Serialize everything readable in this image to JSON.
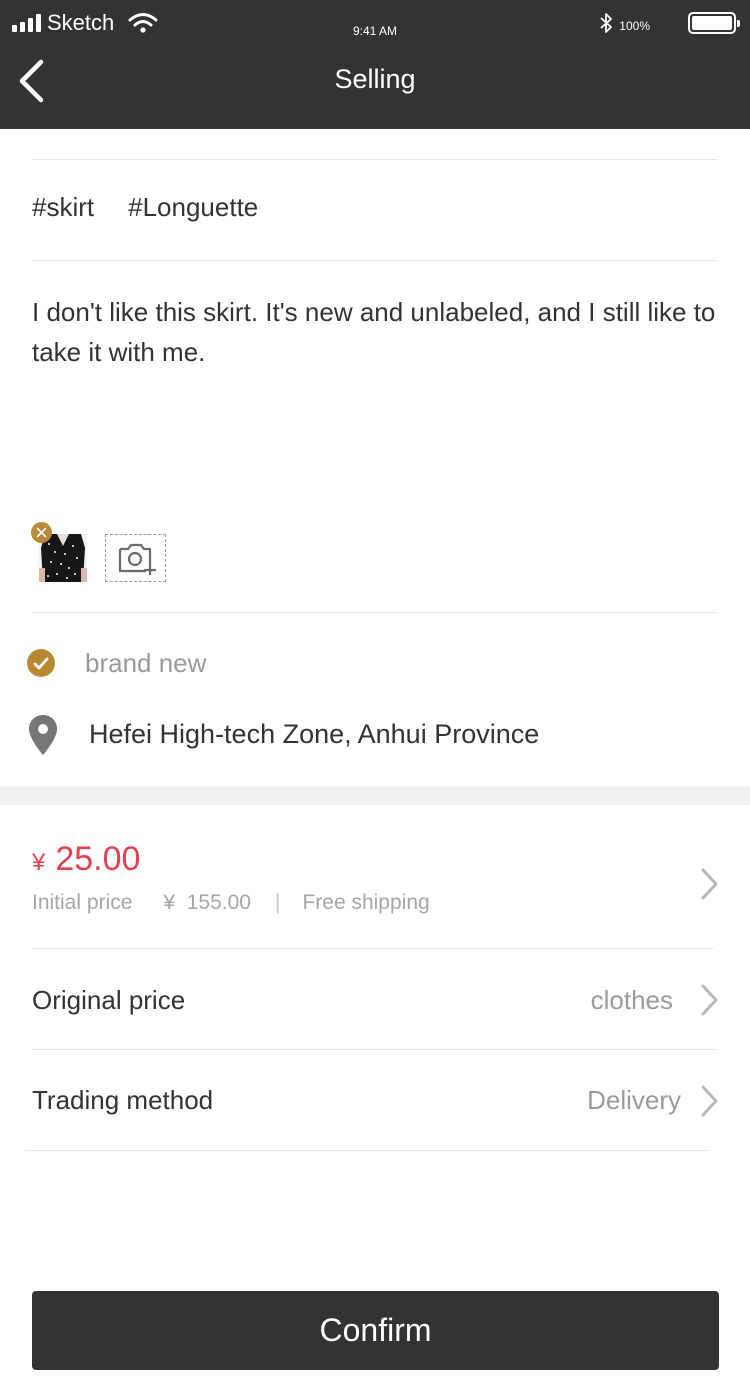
{
  "status_bar": {
    "carrier": "Sketch",
    "time": "9:41 AM",
    "battery_percent": "100%"
  },
  "header": {
    "title": "Selling",
    "back_icon": "chevron-left-icon"
  },
  "tags": [
    "#skirt",
    "#Longuette"
  ],
  "description": "I don't like this skirt. It's new and unlabeled, and I still like to take it with me.",
  "photos": {
    "remove_icon": "close-icon",
    "add_icon": "camera-add-icon"
  },
  "condition": {
    "label": "brand new",
    "icon": "check-circle-icon"
  },
  "location": {
    "label": "Hefei High-tech Zone, Anhui Province",
    "icon": "map-pin-icon"
  },
  "pricing": {
    "currency": "¥",
    "price": "25.00",
    "initial_label": "Initial price",
    "initial_value": "¥  155.00",
    "separator": "|",
    "shipping": "Free shipping"
  },
  "rows": [
    {
      "label": "Original price",
      "value": "clothes"
    },
    {
      "label": "Trading method",
      "value": "Delivery"
    }
  ],
  "confirm_label": "Confirm",
  "colors": {
    "header_bg": "#333333",
    "accent_gold": "#b8892f",
    "price_red": "#e04250",
    "muted_text": "#9a9a9a"
  }
}
